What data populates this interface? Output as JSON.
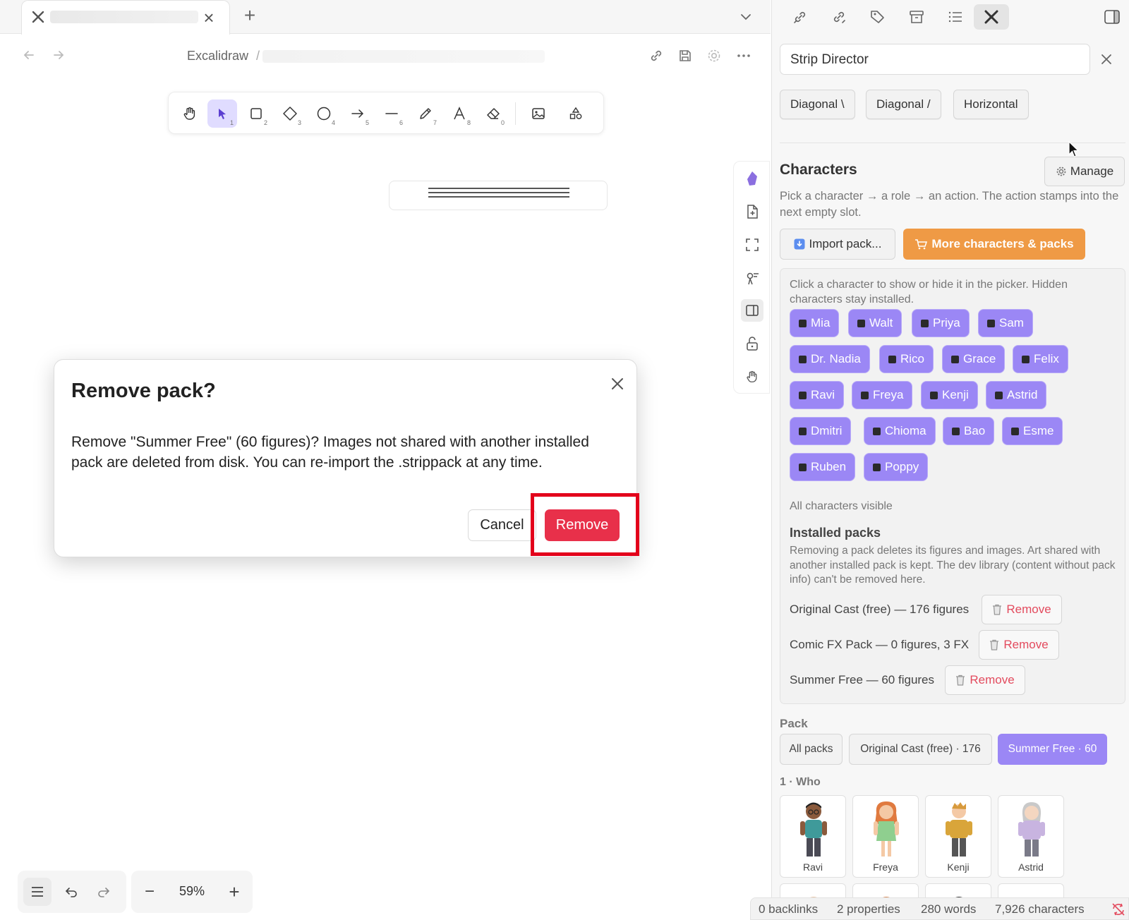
{
  "tab": {
    "close_label": "×",
    "new_label": "+"
  },
  "breadcrumb": {
    "root": "Excalidraw",
    "sep": "/"
  },
  "toolbar": {
    "tools": [
      {
        "name": "hand",
        "key": ""
      },
      {
        "name": "selection",
        "key": "1"
      },
      {
        "name": "rectangle",
        "key": "2"
      },
      {
        "name": "diamond",
        "key": "3"
      },
      {
        "name": "ellipse",
        "key": "4"
      },
      {
        "name": "arrow",
        "key": "5"
      },
      {
        "name": "line",
        "key": "6"
      },
      {
        "name": "pencil",
        "key": "7"
      },
      {
        "name": "text",
        "key": "8"
      },
      {
        "name": "eraser",
        "key": "0"
      },
      {
        "name": "image",
        "key": ""
      },
      {
        "name": "shapes-library",
        "key": ""
      }
    ],
    "active": "selection",
    "accent": "#e0dcff"
  },
  "zoom": {
    "value": "59%",
    "minus": "−",
    "plus": "+"
  },
  "dialog": {
    "title": "Remove pack?",
    "body": "Remove \"Summer Free\" (60 figures)? Images not shared with another installed pack are deleted from disk. You can re-import the .strippack at any time.",
    "cancel_label": "Cancel",
    "remove_label": "Remove",
    "remove_color": "#e8304a",
    "highlight_color": "#e3001b"
  },
  "right": {
    "search_value": "Strip Director",
    "directions": [
      "Diagonal \\",
      "Diagonal /",
      "Horizontal"
    ],
    "characters_title": "Characters",
    "manage_label": "Manage",
    "characters_desc": "Pick a character → a role → an action. The action stamps into the next empty slot.",
    "import_label": "Import pack...",
    "more_label": "More characters & packs",
    "more_color": "#ef9a45",
    "panel_hint": "Click a character to show or hide it in the picker. Hidden characters stay installed.",
    "chips": [
      "Mia",
      "Walt",
      "Priya",
      "Sam",
      "Dr. Nadia",
      "Rico",
      "Grace",
      "Felix",
      "Ravi",
      "Freya",
      "Kenji",
      "Astrid",
      "Dmitri",
      "Chioma",
      "Bao",
      "Esme",
      "Ruben",
      "Poppy"
    ],
    "chip_color": "#9b87f5",
    "all_visible": "All characters visible",
    "installed_title": "Installed packs",
    "installed_desc": "Removing a pack deletes its figures and images. Art shared with another installed pack is kept. The dev library (content without pack info) can't be removed here.",
    "packs": [
      {
        "label": "Original Cast (free) — 176 figures",
        "remove": "Remove"
      },
      {
        "label": "Comic FX Pack — 0 figures, 3 FX",
        "remove": "Remove"
      },
      {
        "label": "Summer Free — 60 figures",
        "remove": "Remove"
      }
    ],
    "pack_title": "Pack",
    "pack_filters": [
      {
        "label": "All packs",
        "active": false
      },
      {
        "label": "Original Cast (free) · 176",
        "active": false
      },
      {
        "label": "Summer Free · 60",
        "active": true
      }
    ],
    "who_title": "1 · Who",
    "figures": [
      "Ravi",
      "Freya",
      "Kenji",
      "Astrid"
    ]
  },
  "status": {
    "backlinks": "0 backlinks",
    "properties": "2 properties",
    "words": "280 words",
    "characters": "7,926 characters"
  }
}
